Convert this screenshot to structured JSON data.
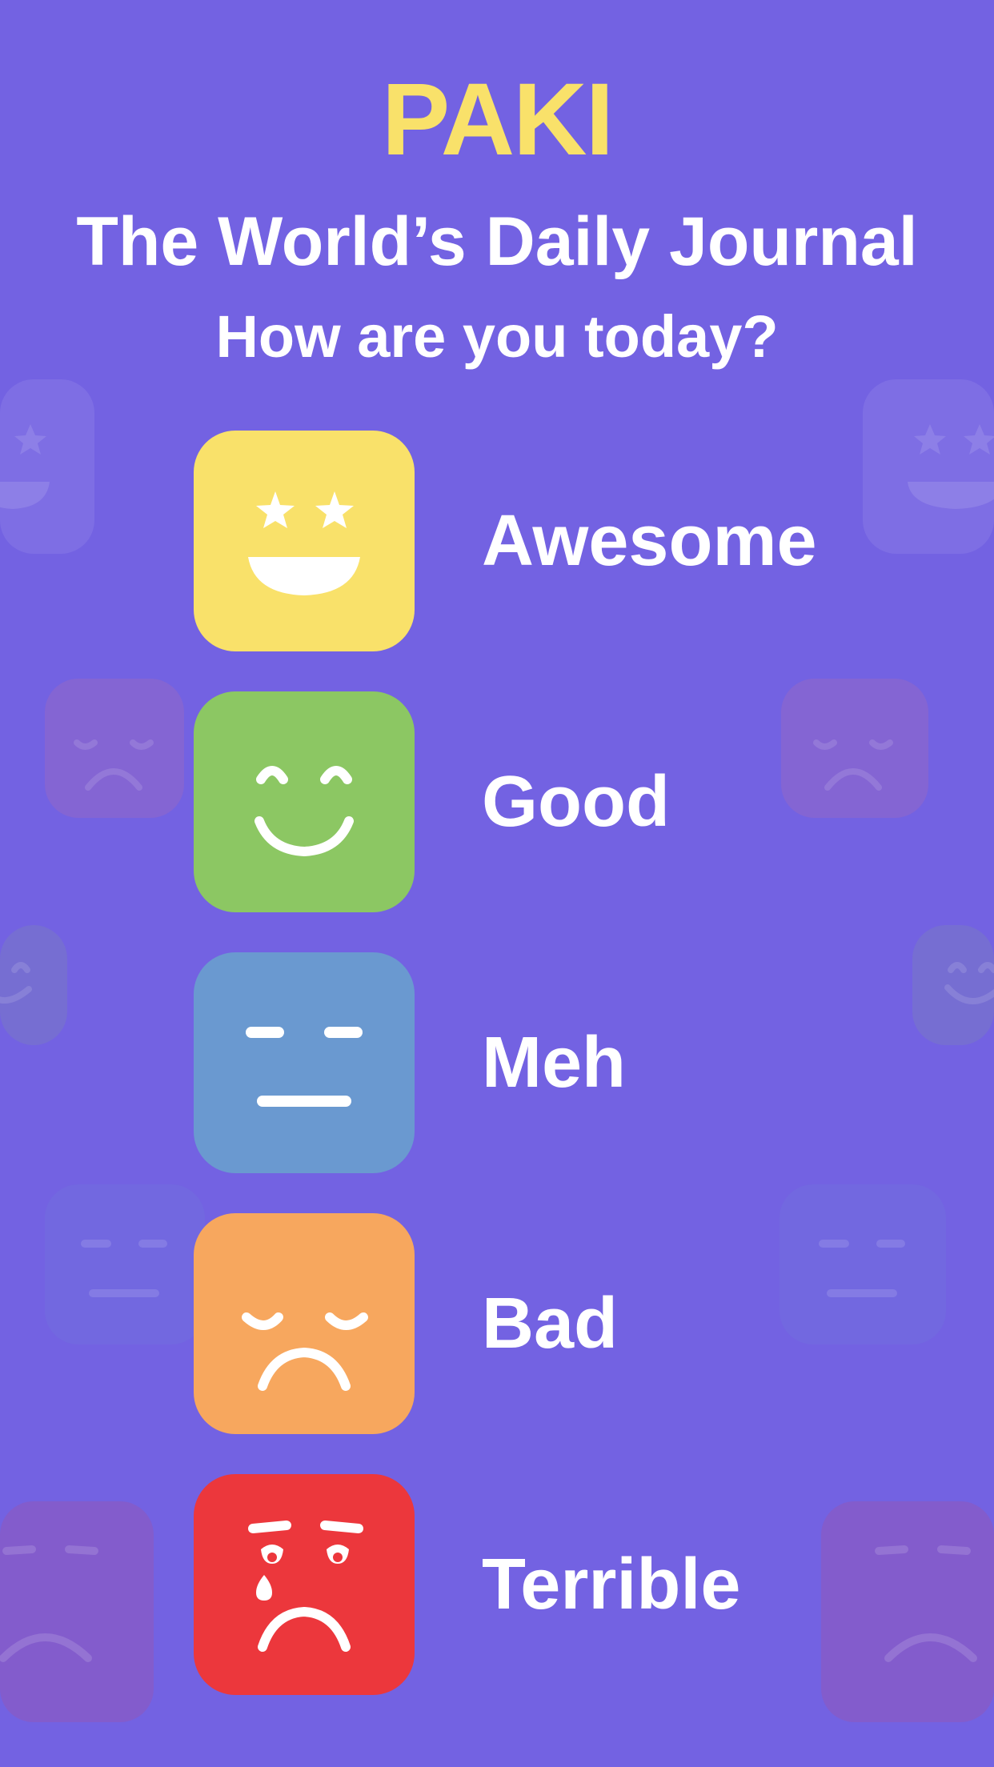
{
  "header": {
    "app_name": "PAKI",
    "tagline": "The World’s Daily Journal",
    "prompt": "How are you today?"
  },
  "colors": {
    "background": "#7362e2",
    "accent": "#f9e16a",
    "text": "#ffffff"
  },
  "moods": [
    {
      "label": "Awesome",
      "color": "#f9e16a",
      "icon": "star-eyes-face-icon"
    },
    {
      "label": "Good",
      "color": "#8cc763",
      "icon": "smiling-face-icon"
    },
    {
      "label": "Meh",
      "color": "#6a99d0",
      "icon": "neutral-face-icon"
    },
    {
      "label": "Bad",
      "color": "#f7a75e",
      "icon": "sad-face-icon"
    },
    {
      "label": "Terrible",
      "color": "#ec373c",
      "icon": "crying-face-icon"
    }
  ]
}
